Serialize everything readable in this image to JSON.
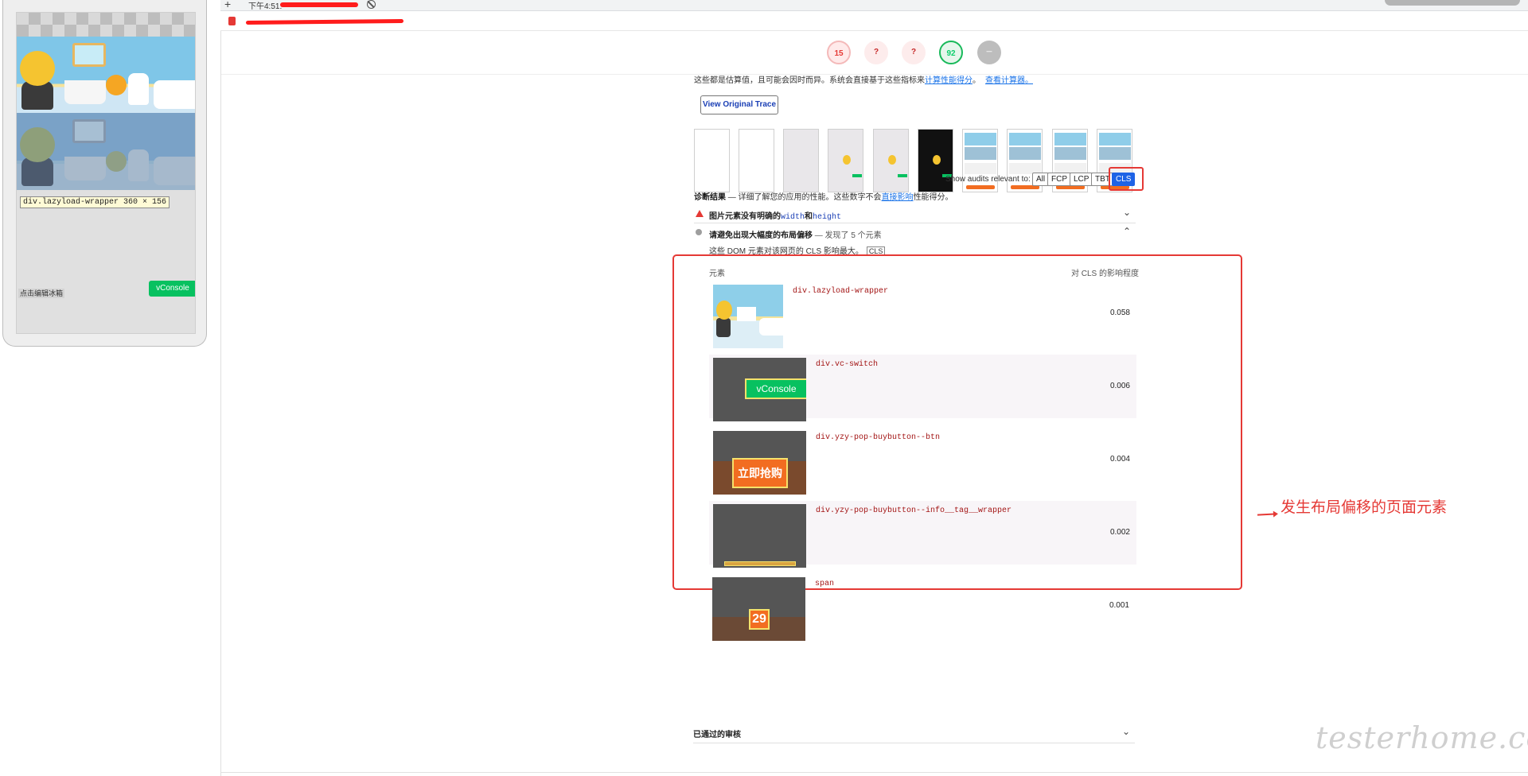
{
  "device": {
    "tooltip_selector": "div.lazyload-wrapper",
    "tooltip_dims": "360 × 156",
    "vconsole_label": "vConsole",
    "edit_hint": "点击编辑冰箱"
  },
  "browser": {
    "tab_time": "下午4:51:",
    "new_tab_glyph": "+"
  },
  "gauges": [
    {
      "label": "15",
      "status": "fail",
      "color": "#e53935"
    },
    {
      "label": "?",
      "status": "unknown",
      "color": "#c62828"
    },
    {
      "label": "?",
      "status": "unknown",
      "color": "#c62828"
    },
    {
      "label": "92",
      "status": "pass",
      "color": "#0cce6b"
    },
    {
      "label": "—",
      "status": "na",
      "color": "#bdbdbd"
    }
  ],
  "report": {
    "estimate_text": "这些都是估算值，且可能会因时而异。系统会直接基于这些指标来",
    "estimate_link1": "计算性能得分",
    "estimate_sep": "。",
    "estimate_link2": "查看计算器。",
    "view_trace_label": "View Original Trace",
    "filter_label": "Show audits relevant to:",
    "filters": [
      "All",
      "FCP",
      "LCP",
      "TBT",
      "CLS"
    ],
    "active_filter": "CLS",
    "diagnostics_title": "诊断结果",
    "diagnostics_desc": "— 详细了解您的应用的性能。这些数字不会",
    "diagnostics_link": "直接影响",
    "diagnostics_tail": "性能得分。",
    "audit1_prefix": "图片元素没有明确的",
    "audit1_code1": "width",
    "audit1_mid": "和",
    "audit1_code2": "height",
    "audit2_title": "请避免出现大幅度的布局偏移",
    "audit2_detail": "— 发现了 5 个元素",
    "cls_desc": "这些 DOM 元素对该网页的 CLS 影响最大。",
    "cls_tag": "CLS",
    "col_element": "元素",
    "col_impact": "对 CLS 的影响程度",
    "thumb_vconsole": "vConsole",
    "thumb_buy": "立即抢购",
    "thumb_number": "29",
    "passed_title": "已通过的审核"
  },
  "cls_elements": [
    {
      "selector": "div.lazyload-wrapper",
      "score": "0.058"
    },
    {
      "selector": "div.vc-switch",
      "score": "0.006"
    },
    {
      "selector": "div.yzy-pop-buybutton--btn",
      "score": "0.004"
    },
    {
      "selector": "div.yzy-pop-buybutton--info__tag__wrapper",
      "score": "0.002"
    },
    {
      "selector": "span",
      "score": "0.001"
    }
  ],
  "annotation": {
    "text": "发生布局偏移的页面元素",
    "color": "#e53935"
  },
  "watermark": "testerhome.com",
  "icons": [
    "lock-icon",
    "block-icon",
    "warning-triangle-icon",
    "info-dot-icon",
    "chevron-down-icon",
    "chevron-up-icon",
    "arrow-icon"
  ]
}
